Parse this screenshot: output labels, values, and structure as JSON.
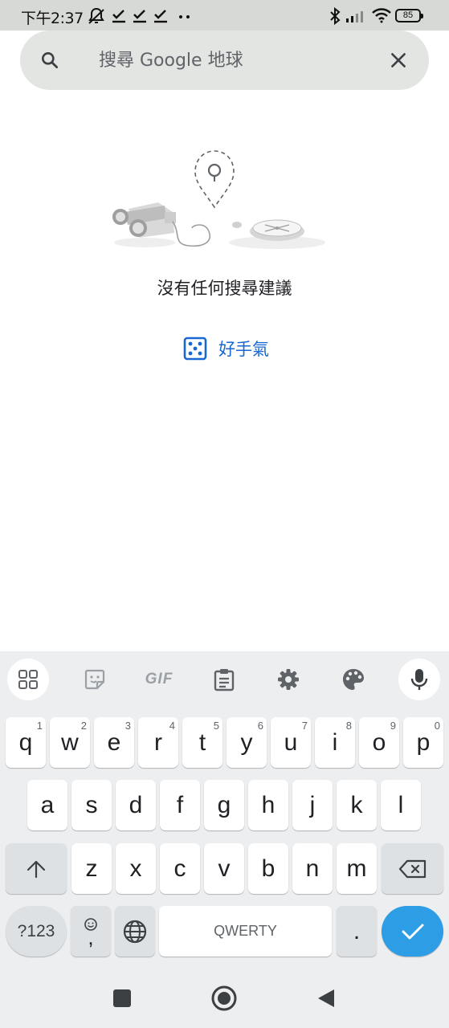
{
  "status_bar": {
    "time": "下午2:37",
    "battery": "85"
  },
  "search": {
    "placeholder": "搜尋 Google 地球"
  },
  "empty_state": {
    "message": "沒有任何搜尋建議",
    "lucky_label": "好手氣"
  },
  "keyboard": {
    "row1": [
      {
        "label": "q",
        "hint": "1"
      },
      {
        "label": "w",
        "hint": "2"
      },
      {
        "label": "e",
        "hint": "3"
      },
      {
        "label": "r",
        "hint": "4"
      },
      {
        "label": "t",
        "hint": "5"
      },
      {
        "label": "y",
        "hint": "6"
      },
      {
        "label": "u",
        "hint": "7"
      },
      {
        "label": "i",
        "hint": "8"
      },
      {
        "label": "o",
        "hint": "9"
      },
      {
        "label": "p",
        "hint": "0"
      }
    ],
    "row2": [
      "a",
      "s",
      "d",
      "f",
      "g",
      "h",
      "j",
      "k",
      "l"
    ],
    "row3": [
      "z",
      "x",
      "c",
      "v",
      "b",
      "n",
      "m"
    ],
    "symbols_label": "?123",
    "comma_label": ",",
    "space_label": "QWERTY",
    "period_label": "."
  },
  "colors": {
    "accent_blue": "#1967d2",
    "enter_key": "#2d9de6",
    "search_bg": "#e3e5e2",
    "keyboard_bg": "#eceef0"
  },
  "icons": {
    "search": "search-icon",
    "clear": "close-icon",
    "lucky": "dice-icon",
    "toolbar": [
      "apps-grid-icon",
      "sticker-icon",
      "gif-icon",
      "clipboard-icon",
      "gear-icon",
      "palette-icon",
      "microphone-icon"
    ],
    "nav": [
      "square-recents-icon",
      "circle-home-icon",
      "triangle-back-icon"
    ]
  }
}
